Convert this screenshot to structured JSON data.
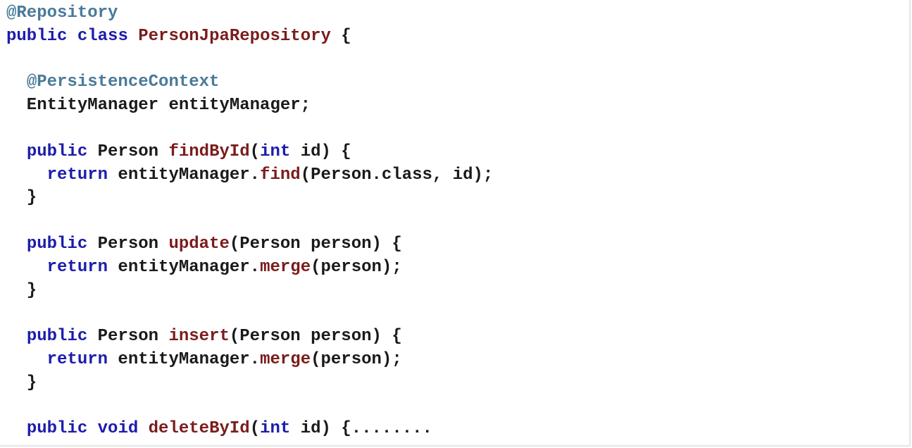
{
  "colors": {
    "annotation": "#4a7a99",
    "keyword": "#1c1cac",
    "method_name": "#7b1c1c",
    "plain": "#1a1a1a",
    "background": "#ffffff"
  },
  "code": {
    "lines": [
      [
        {
          "t": "annotation",
          "v": "@Repository"
        }
      ],
      [
        {
          "t": "keyword",
          "v": "public"
        },
        {
          "t": "plain",
          "v": " "
        },
        {
          "t": "keyword",
          "v": "class"
        },
        {
          "t": "plain",
          "v": " "
        },
        {
          "t": "method",
          "v": "PersonJpaRepository"
        },
        {
          "t": "plain",
          "v": " {"
        }
      ],
      [],
      [
        {
          "t": "plain",
          "v": "  "
        },
        {
          "t": "annotation",
          "v": "@PersistenceContext"
        }
      ],
      [
        {
          "t": "plain",
          "v": "  EntityManager entityManager;"
        }
      ],
      [],
      [
        {
          "t": "plain",
          "v": "  "
        },
        {
          "t": "keyword",
          "v": "public"
        },
        {
          "t": "plain",
          "v": " Person "
        },
        {
          "t": "method",
          "v": "findById"
        },
        {
          "t": "plain",
          "v": "("
        },
        {
          "t": "keyword",
          "v": "int"
        },
        {
          "t": "plain",
          "v": " id) {"
        }
      ],
      [
        {
          "t": "plain",
          "v": "    "
        },
        {
          "t": "keyword",
          "v": "return"
        },
        {
          "t": "plain",
          "v": " entityManager."
        },
        {
          "t": "method",
          "v": "find"
        },
        {
          "t": "plain",
          "v": "(Person.class, id);"
        }
      ],
      [
        {
          "t": "plain",
          "v": "  }"
        }
      ],
      [],
      [
        {
          "t": "plain",
          "v": "  "
        },
        {
          "t": "keyword",
          "v": "public"
        },
        {
          "t": "plain",
          "v": " Person "
        },
        {
          "t": "method",
          "v": "update"
        },
        {
          "t": "plain",
          "v": "(Person person) {"
        }
      ],
      [
        {
          "t": "plain",
          "v": "    "
        },
        {
          "t": "keyword",
          "v": "return"
        },
        {
          "t": "plain",
          "v": " entityManager."
        },
        {
          "t": "method",
          "v": "merge"
        },
        {
          "t": "plain",
          "v": "(person);"
        }
      ],
      [
        {
          "t": "plain",
          "v": "  }"
        }
      ],
      [],
      [
        {
          "t": "plain",
          "v": "  "
        },
        {
          "t": "keyword",
          "v": "public"
        },
        {
          "t": "plain",
          "v": " Person "
        },
        {
          "t": "method",
          "v": "insert"
        },
        {
          "t": "plain",
          "v": "(Person person) {"
        }
      ],
      [
        {
          "t": "plain",
          "v": "    "
        },
        {
          "t": "keyword",
          "v": "return"
        },
        {
          "t": "plain",
          "v": " entityManager."
        },
        {
          "t": "method",
          "v": "merge"
        },
        {
          "t": "plain",
          "v": "(person);"
        }
      ],
      [
        {
          "t": "plain",
          "v": "  }"
        }
      ],
      [],
      [
        {
          "t": "plain",
          "v": "  "
        },
        {
          "t": "keyword",
          "v": "public"
        },
        {
          "t": "plain",
          "v": " "
        },
        {
          "t": "keyword",
          "v": "void"
        },
        {
          "t": "plain",
          "v": " "
        },
        {
          "t": "method",
          "v": "deleteById"
        },
        {
          "t": "plain",
          "v": "("
        },
        {
          "t": "keyword",
          "v": "int"
        },
        {
          "t": "plain",
          "v": " id) {........"
        }
      ]
    ]
  }
}
